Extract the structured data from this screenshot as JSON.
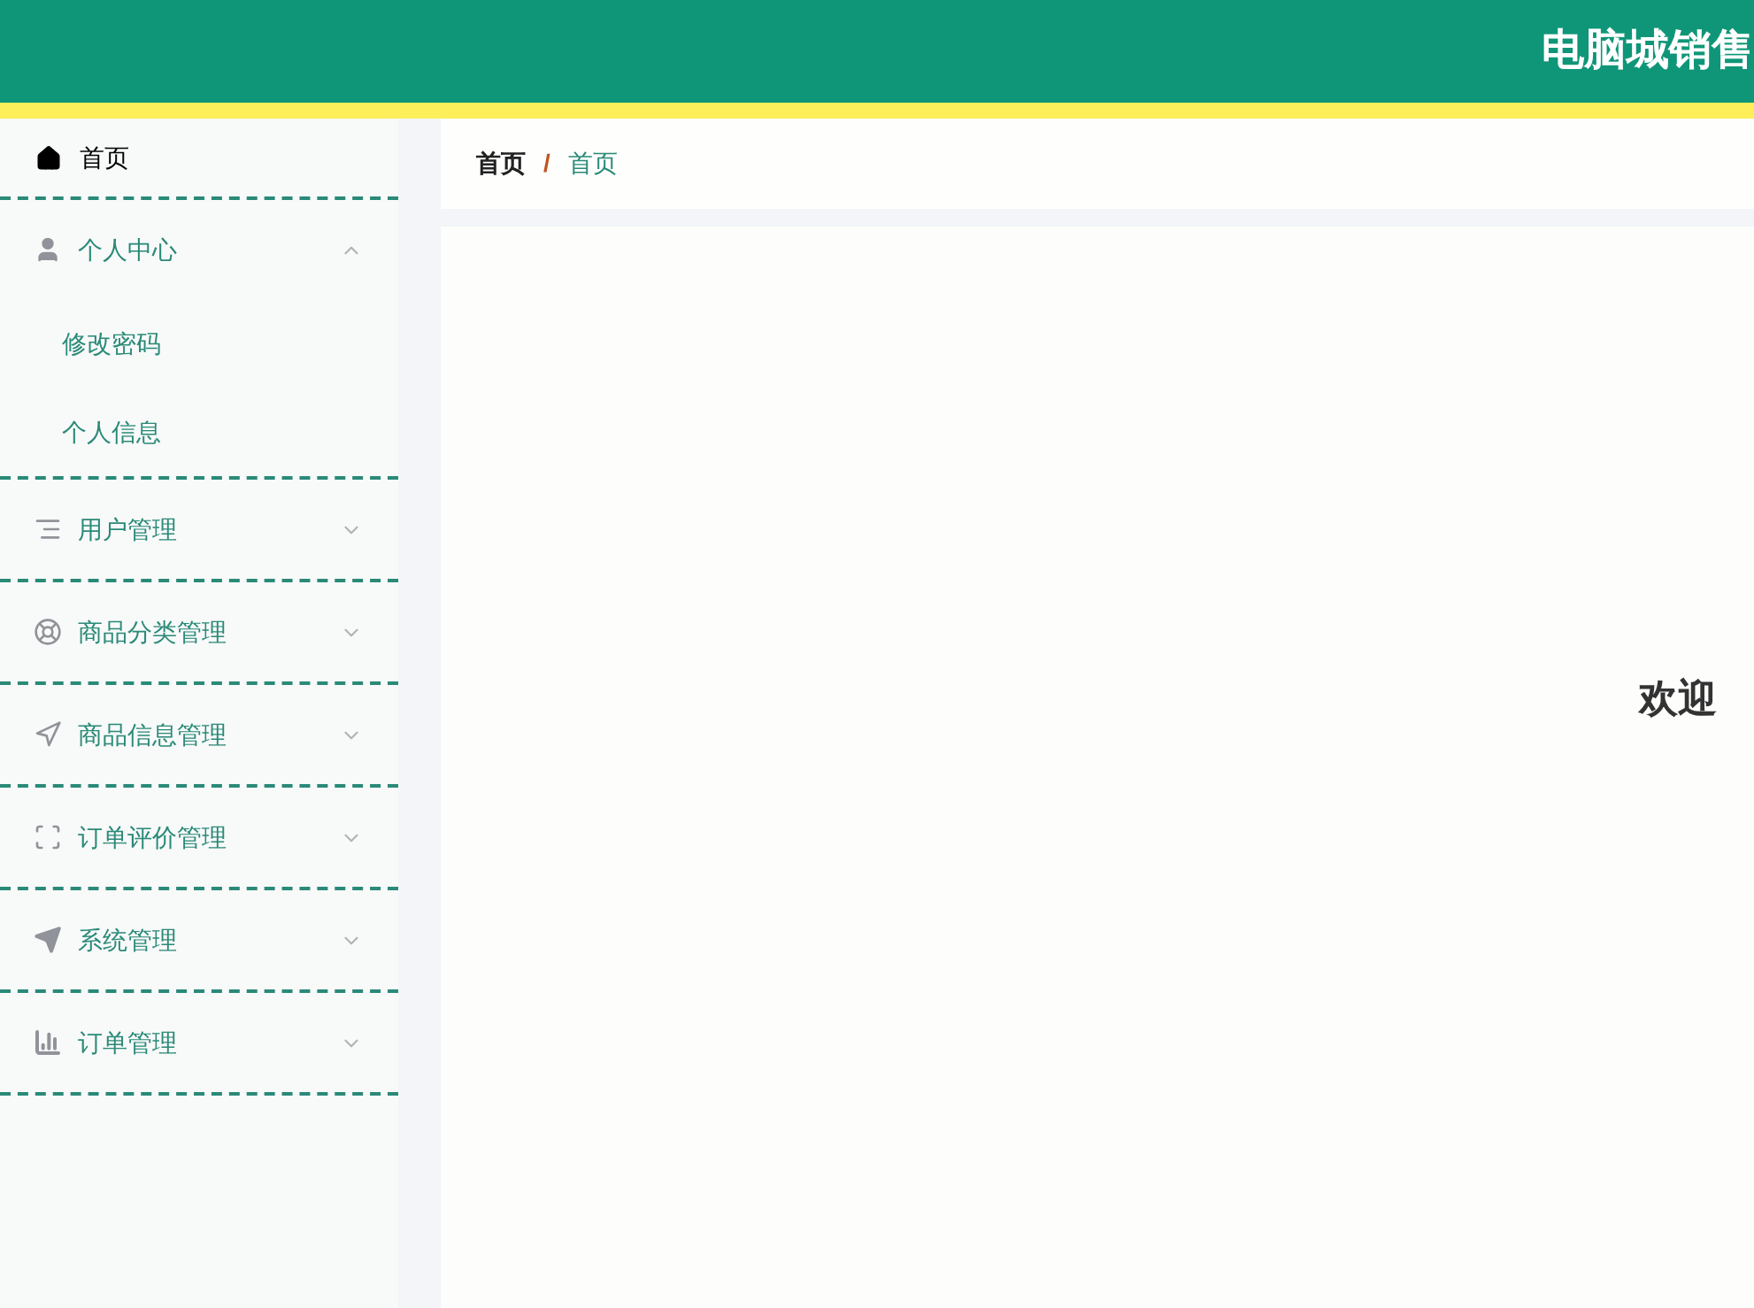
{
  "header": {
    "title": "电脑城销售"
  },
  "sidebar": {
    "items": [
      {
        "kind": "link",
        "label": "首页",
        "selected": true
      },
      {
        "kind": "group",
        "label": "个人中心",
        "expanded": true,
        "children": [
          {
            "label": "修改密码"
          },
          {
            "label": "个人信息"
          }
        ]
      },
      {
        "kind": "group",
        "label": "用户管理",
        "expanded": false
      },
      {
        "kind": "group",
        "label": "商品分类管理",
        "expanded": false
      },
      {
        "kind": "group",
        "label": "商品信息管理",
        "expanded": false
      },
      {
        "kind": "group",
        "label": "订单评价管理",
        "expanded": false
      },
      {
        "kind": "group",
        "label": "系统管理",
        "expanded": false
      },
      {
        "kind": "group",
        "label": "订单管理",
        "expanded": false
      }
    ]
  },
  "breadcrumb": {
    "items": [
      "首页",
      "首页"
    ],
    "separator": "/"
  },
  "content": {
    "welcome": "欢迎"
  }
}
